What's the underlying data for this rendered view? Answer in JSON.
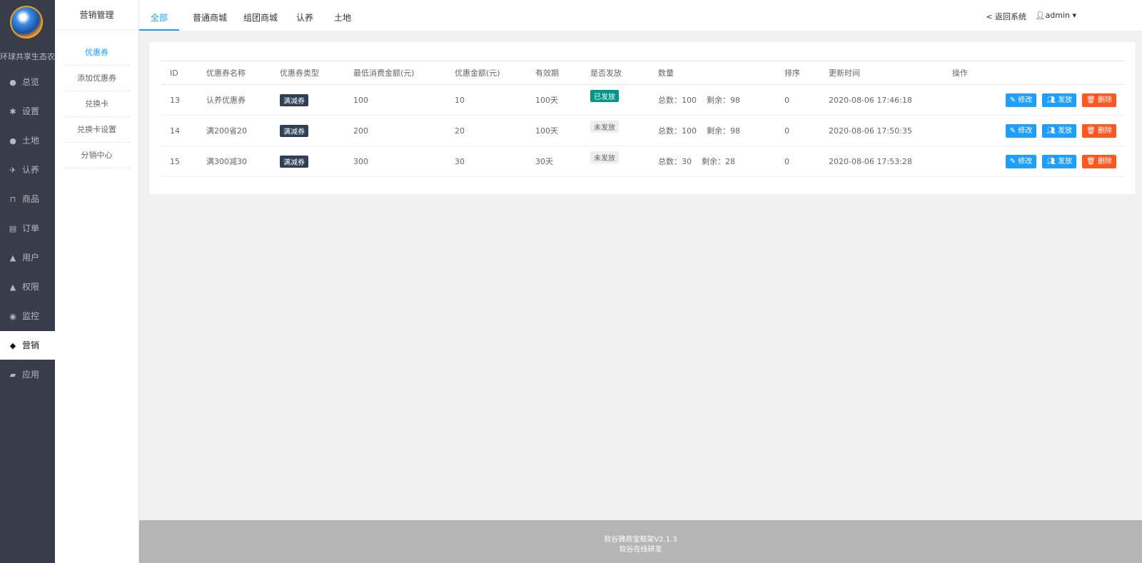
{
  "app": {
    "brand": "环球共享生态农业"
  },
  "nav": [
    {
      "label": "总览",
      "icon": "globe-icon",
      "glyph": "●",
      "active": false
    },
    {
      "label": "设置",
      "icon": "gear-icon",
      "glyph": "✱",
      "active": false
    },
    {
      "label": "土地",
      "icon": "globe-icon",
      "glyph": "●",
      "active": false
    },
    {
      "label": "认养",
      "icon": "bird-icon",
      "glyph": "✈",
      "active": false
    },
    {
      "label": "商品",
      "icon": "cart-icon",
      "glyph": "⊓",
      "active": false
    },
    {
      "label": "订单",
      "icon": "list-icon",
      "glyph": "▤",
      "active": false
    },
    {
      "label": "用户",
      "icon": "user-icon",
      "glyph": "▲",
      "active": false
    },
    {
      "label": "权限",
      "icon": "user-icon",
      "glyph": "▲",
      "active": false
    },
    {
      "label": "监控",
      "icon": "play-circle-icon",
      "glyph": "◉",
      "active": false
    },
    {
      "label": "营销",
      "icon": "tags-icon",
      "glyph": "◆",
      "active": true
    },
    {
      "label": "应用",
      "icon": "book-icon",
      "glyph": "▰",
      "active": false
    }
  ],
  "submenu": {
    "title": "营销管理",
    "items": [
      {
        "label": "优惠券",
        "active": true
      },
      {
        "label": "添加优惠券",
        "active": false
      },
      {
        "label": "兑换卡",
        "active": false
      },
      {
        "label": "兑换卡设置",
        "active": false
      },
      {
        "label": "分销中心",
        "active": false
      }
    ]
  },
  "tabs": [
    {
      "label": "全部",
      "active": true
    },
    {
      "label": "普通商城",
      "active": false
    },
    {
      "label": "组团商城",
      "active": false
    },
    {
      "label": "认养",
      "active": false
    },
    {
      "label": "土地",
      "active": false
    }
  ],
  "header": {
    "return_label": "< 返回系统",
    "user_label": "admin ▾",
    "user_icon": "user-icon"
  },
  "table": {
    "columns": [
      "ID",
      "优惠券名称",
      "优惠券类型",
      "最低消费金额(元)",
      "优惠金额(元)",
      "有效期",
      "是否发放",
      "数量",
      "排序",
      "更新时间",
      "操作"
    ],
    "rows": [
      {
        "id": "13",
        "name": "认养优惠券",
        "type": "满减券",
        "min": "100",
        "discount": "10",
        "validity": "100天",
        "issued": "已发放",
        "issued_flag": true,
        "total": "总数：100",
        "remain": "剩余：98",
        "sort": "0",
        "updated": "2020-08-06 17:46:18"
      },
      {
        "id": "14",
        "name": "满200省20",
        "type": "满减券",
        "min": "200",
        "discount": "20",
        "validity": "100天",
        "issued": "未发放",
        "issued_flag": false,
        "total": "总数：100",
        "remain": "剩余：98",
        "sort": "0",
        "updated": "2020-08-06 17:50:35"
      },
      {
        "id": "15",
        "name": "满300减30",
        "type": "满减券",
        "min": "300",
        "discount": "30",
        "validity": "30天",
        "issued": "未发放",
        "issued_flag": false,
        "total": "总数：30",
        "remain": "剩余：28",
        "sort": "0",
        "updated": "2020-08-06 17:53:28"
      }
    ],
    "actions": {
      "edit": "修改",
      "issue": "发放",
      "delete": "删除"
    }
  },
  "footer": {
    "line1": "软谷微商宝框架V2.1.3",
    "line2": "软谷在线研发"
  },
  "colors": {
    "sidebar": "#393d49",
    "accent": "#1e9fff",
    "danger": "#ff5722",
    "success": "#009688",
    "tag_dark": "#2f4056"
  }
}
